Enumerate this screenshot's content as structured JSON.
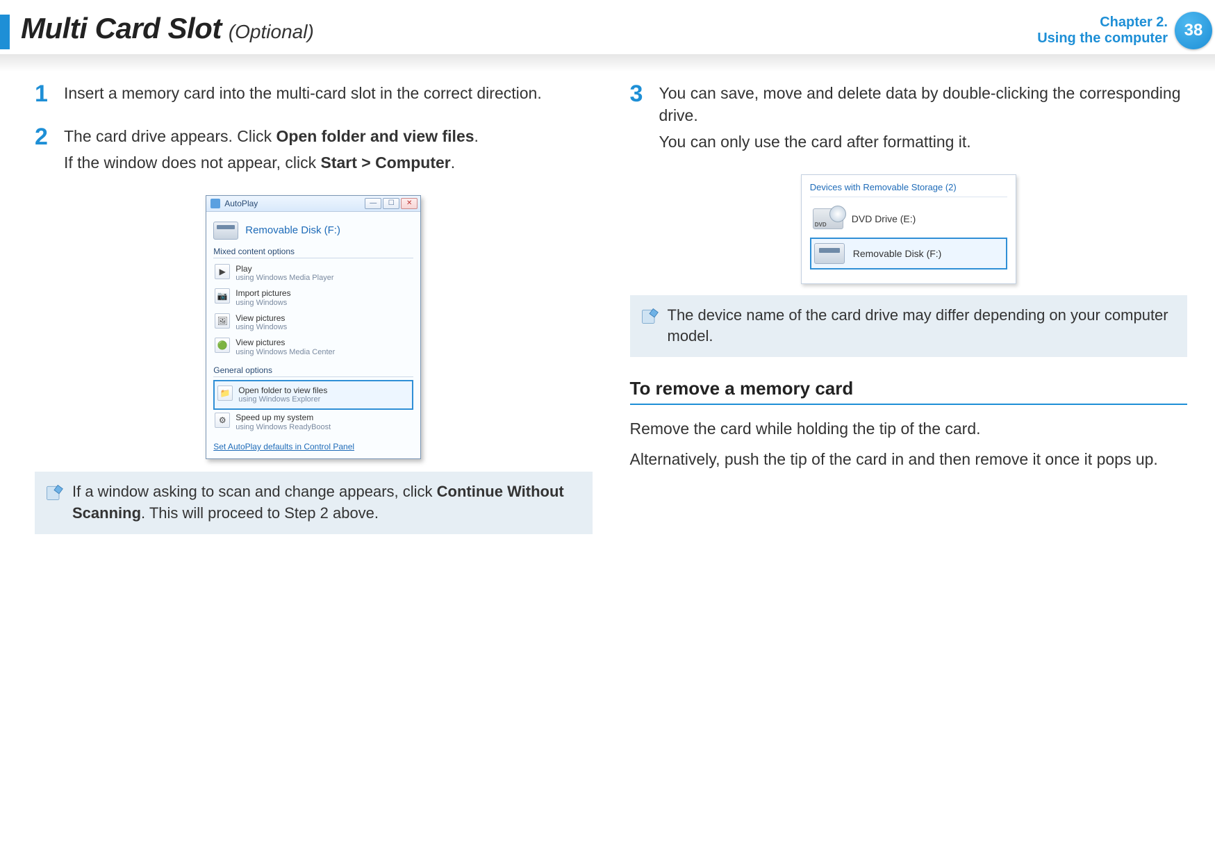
{
  "header": {
    "title_main": "Multi Card Slot",
    "title_sub": "(Optional)",
    "chapter_line1": "Chapter 2.",
    "chapter_line2": "Using the computer",
    "page_number": "38"
  },
  "left": {
    "steps": [
      {
        "num": "1",
        "lines": [
          "Insert a memory card into the multi-card slot in the correct direction."
        ]
      },
      {
        "num": "2",
        "lines_html": "The card drive appears. Click <b>Open folder and view files</b>.",
        "line2_html": "If the window does not appear, click <b>Start > Computer</b>."
      }
    ],
    "autoplay": {
      "titlebar": "AutoPlay",
      "removable_label": "Removable Disk (F:)",
      "group_mixed": "Mixed content options",
      "options": [
        {
          "icon": "▶",
          "l1": "Play",
          "l2": "using Windows Media Player"
        },
        {
          "icon": "📷",
          "l1": "Import pictures",
          "l2": "using Windows"
        },
        {
          "icon": "🖼",
          "l1": "View pictures",
          "l2": "using Windows"
        },
        {
          "icon": "🟢",
          "l1": "View pictures",
          "l2": "using Windows Media Center"
        }
      ],
      "group_general": "General options",
      "highlight": {
        "icon": "📁",
        "l1": "Open folder to view files",
        "l2": "using Windows Explorer"
      },
      "speedup": {
        "icon": "⚙",
        "l1": "Speed up my system",
        "l2": "using Windows ReadyBoost"
      },
      "defaults_link": "Set AutoPlay defaults in Control Panel"
    },
    "note_html": "If a window asking to scan and change appears, click <b>Continue Without Scanning</b>. This will proceed to Step 2 above."
  },
  "right": {
    "step3": {
      "num": "3",
      "line1": "You can save, move and delete data by double-clicking the corresponding drive.",
      "line2": "You can only use the card after formatting it."
    },
    "devices": {
      "header": "Devices with Removable Storage (2)",
      "dvd": "DVD Drive (E:)",
      "dvd_badge": "DVD",
      "removable": "Removable Disk (F:)"
    },
    "note": "The device name of the card drive may differ depending on your computer model.",
    "section_title": "To remove a memory card",
    "remove_p1": "Remove the card while holding the tip of the card.",
    "remove_p2": "Alternatively, push the tip of the card in and then remove it once it pops up."
  }
}
